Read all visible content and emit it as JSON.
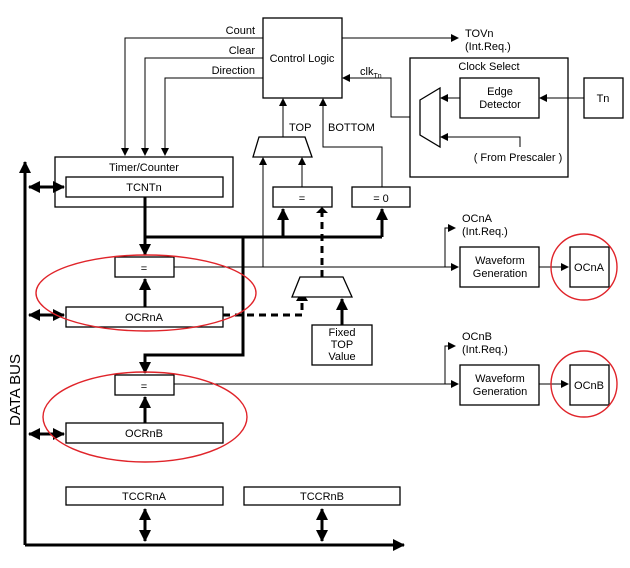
{
  "control_logic": {
    "label": "Control Logic",
    "signals": [
      "Count",
      "Clear",
      "Direction"
    ]
  },
  "tov": {
    "name": "TOVn",
    "sub": "(Int.Req.)"
  },
  "clk": {
    "main": "clk",
    "sub": "Tn"
  },
  "clock_select": {
    "title": "Clock Select",
    "edge_line1": "Edge",
    "edge_line2": "Detector",
    "tn": "Tn",
    "prescaler": "( From Prescaler )"
  },
  "labels": {
    "top": "TOP",
    "bottom": "BOTTOM",
    "eq": "=",
    "eq0": "= 0"
  },
  "timer_counter": {
    "title": "Timer/Counter",
    "reg": "TCNTn"
  },
  "ocra": {
    "reg": "OCRnA",
    "out": "OCnA",
    "int": "OCnA",
    "int_sub": "(Int.Req.)",
    "wf1": "Waveform",
    "wf2": "Generation"
  },
  "ocrb": {
    "reg": "OCRnB",
    "out": "OCnB",
    "int": "OCnB",
    "int_sub": "(Int.Req.)",
    "wf1": "Waveform",
    "wf2": "Generation"
  },
  "fixed_top": [
    "Fixed",
    "TOP",
    "Value"
  ],
  "data_bus": "DATA BUS",
  "tccr": [
    "TCCRnA",
    "TCCRnB"
  ],
  "highlight_color": "#e0242a"
}
